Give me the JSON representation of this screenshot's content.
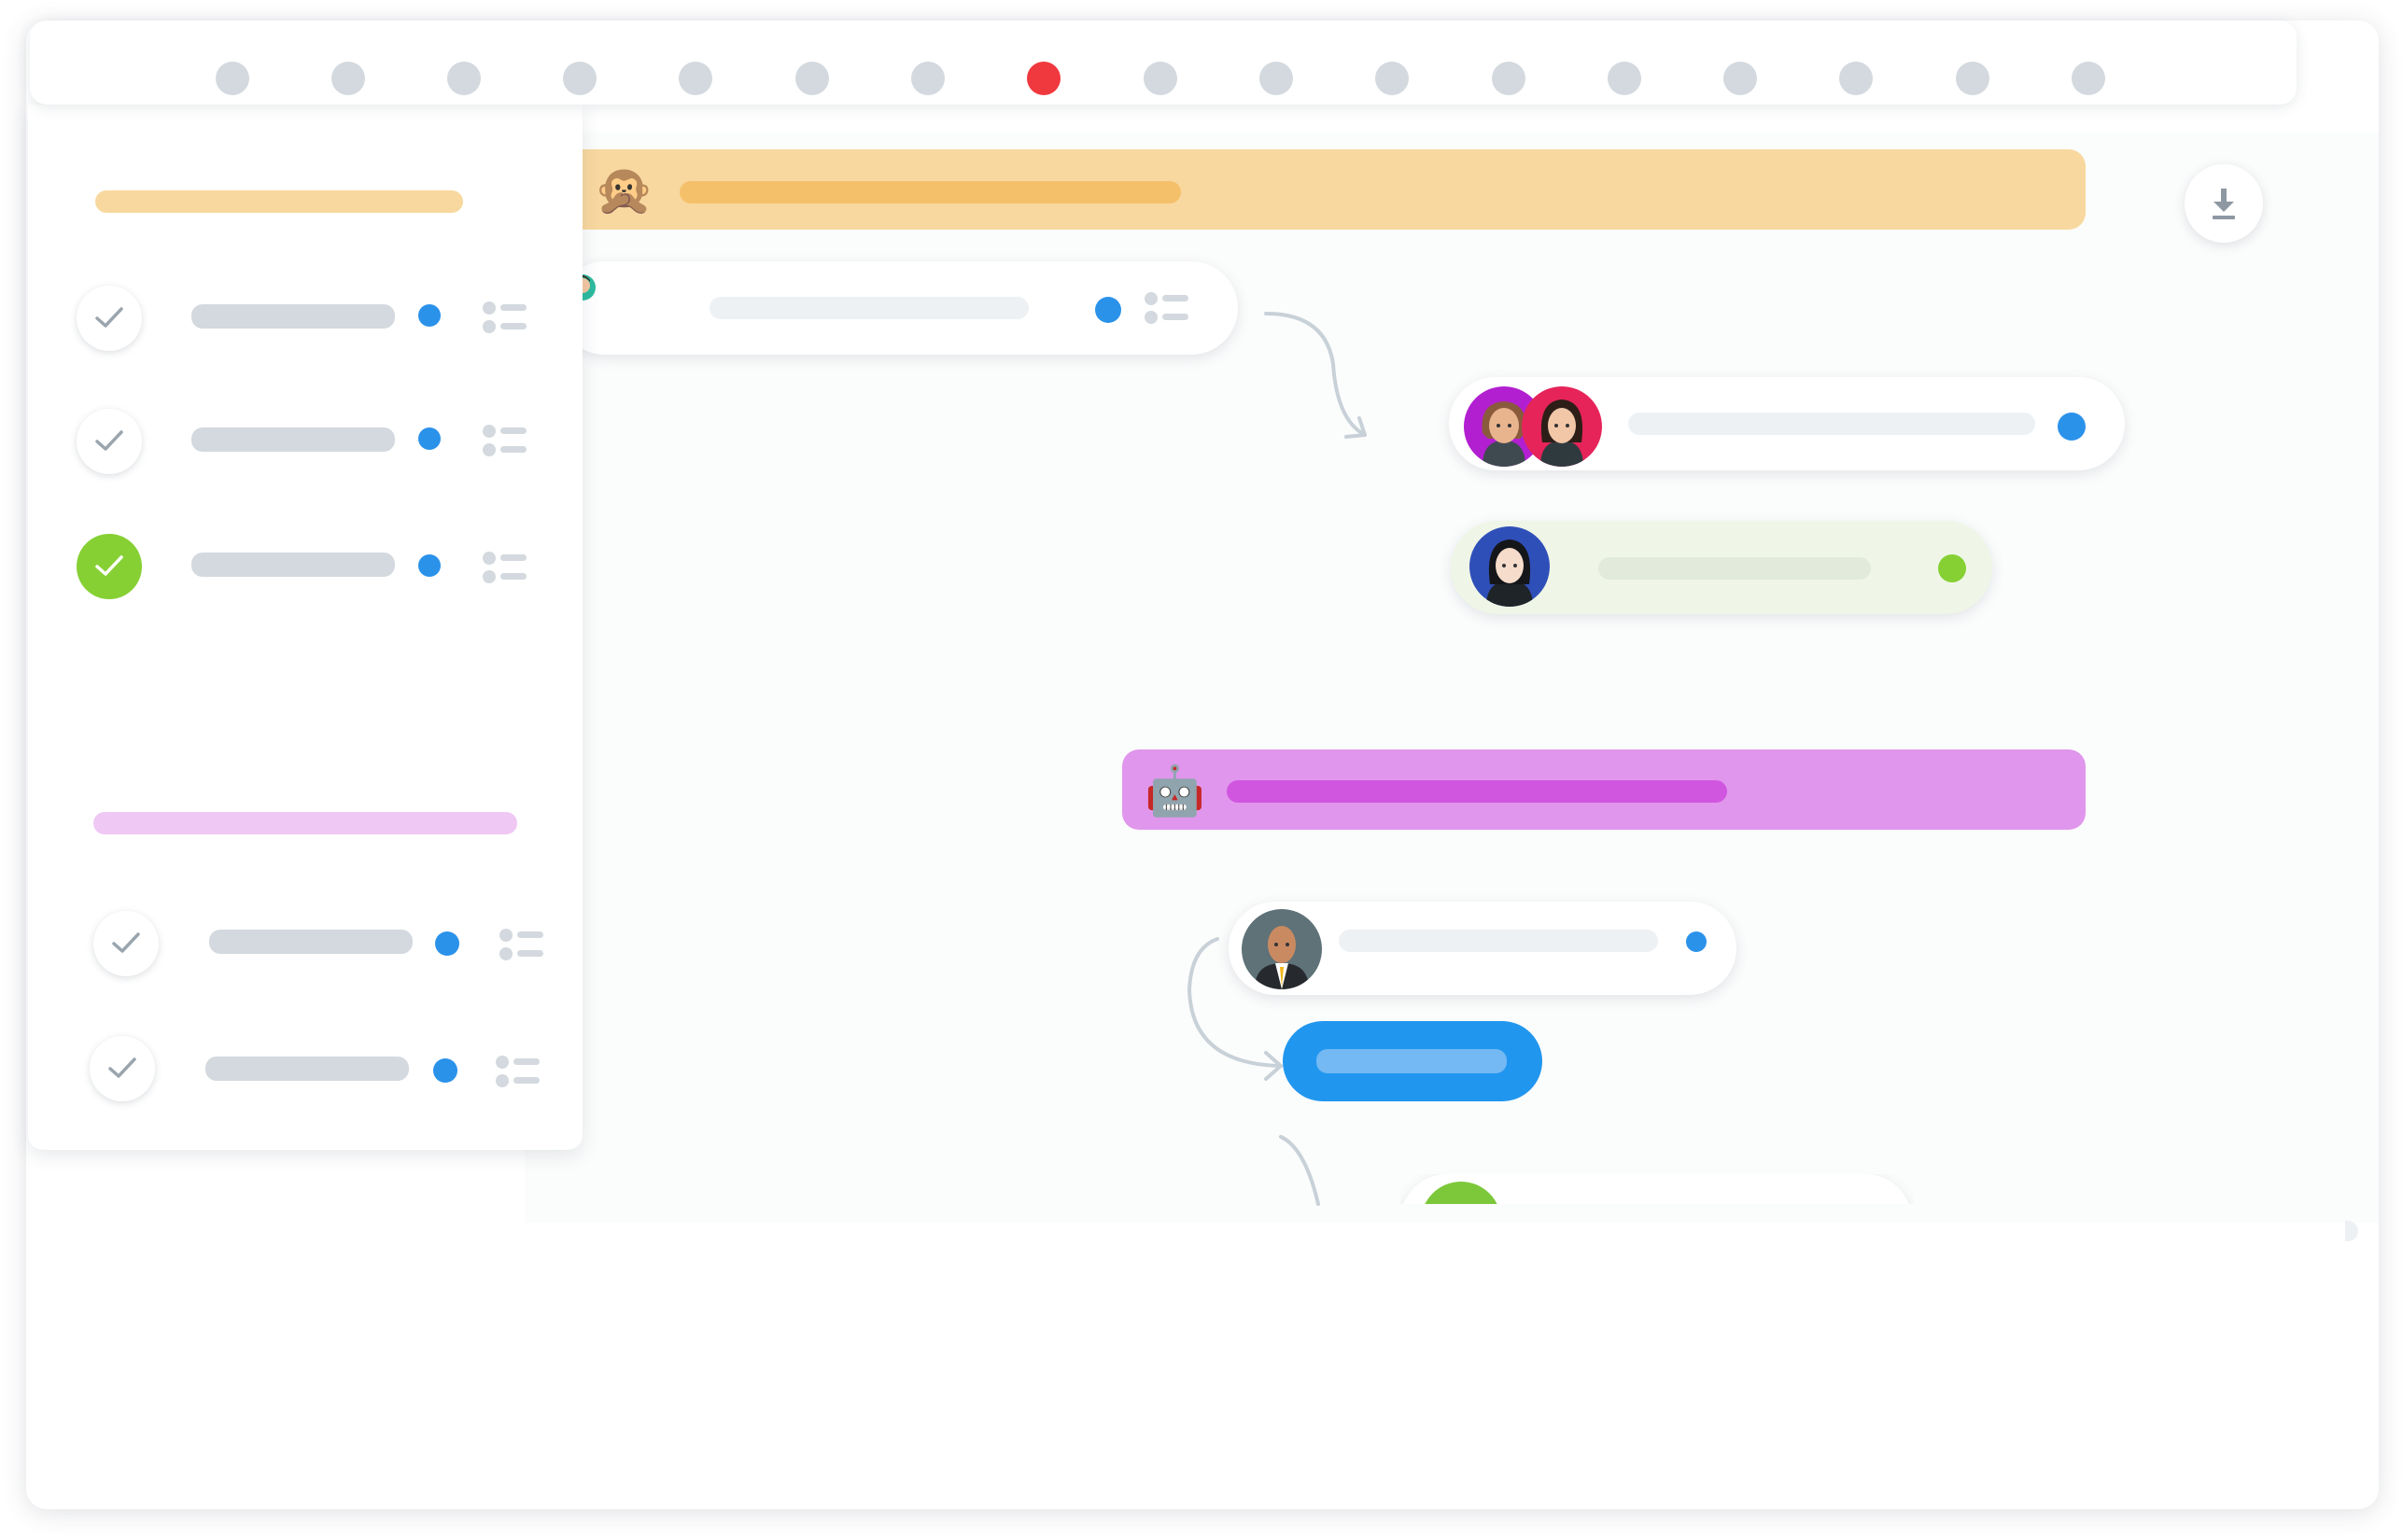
{
  "colors": {
    "accent": "#2196ef",
    "active_step": "#f0383f",
    "phase_one": "#f8d89f",
    "phase_two": "#e096ec",
    "done": "#86d034",
    "status_blue": "#2b92ea",
    "status_green": "#86d034"
  },
  "timeline": {
    "steps": 17,
    "active_index": 7
  },
  "sidebar": {
    "groups": [
      {
        "color": "orange",
        "items": [
          {
            "completed": false,
            "status": "blue"
          },
          {
            "completed": false,
            "status": "blue"
          },
          {
            "completed": true,
            "status": "blue"
          }
        ]
      },
      {
        "color": "purple",
        "items": [
          {
            "completed": false,
            "status": "blue"
          },
          {
            "completed": false,
            "status": "blue"
          }
        ]
      }
    ]
  },
  "phases": [
    {
      "emoji": "🙊",
      "color": "orange"
    },
    {
      "emoji": "🤖",
      "color": "purple"
    }
  ],
  "icons": {
    "download": "download-icon",
    "check": "check-icon",
    "list": "list-icon"
  }
}
